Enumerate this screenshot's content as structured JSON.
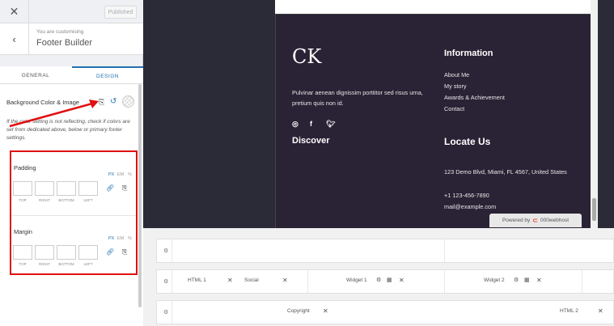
{
  "topbar": {
    "close_icon": "close-icon",
    "published_label": "Published"
  },
  "section": {
    "customizing_label": "You are customising",
    "title": "Footer Builder"
  },
  "tabs": {
    "general": "GENERAL",
    "design": "DESIGN"
  },
  "background": {
    "label": "Background Color & Image",
    "note": "If the color setting is not reflecting, check if colors are set from dedicated above, below or primary footer settings."
  },
  "padding": {
    "title": "Padding",
    "units": [
      "PX",
      "EM",
      "%"
    ],
    "active_unit": "PX",
    "sides": [
      "TOP",
      "RIGHT",
      "BOTTOM",
      "LEFT"
    ]
  },
  "margin": {
    "title": "Margin",
    "units": [
      "PX",
      "EM",
      "%"
    ],
    "active_unit": "PX",
    "sides": [
      "TOP",
      "RIGHT",
      "BOTTOM",
      "LEFT"
    ]
  },
  "footer": {
    "logo": "CK",
    "about": "Pulvinar aenean dignissim porttitor sed risus urna, pretium quis non id.",
    "social_icons": [
      "instagram-icon",
      "facebook-icon",
      "twitter-icon"
    ],
    "info_title": "Information",
    "info_links": [
      "About Me",
      "My story",
      "Awards & Achievement",
      "Contact"
    ],
    "discover_title": "Discover",
    "locate_title": "Locate Us",
    "address": "123 Demo Blvd, Miami, FL 4567, United States",
    "phone": "+1 123-456-7890",
    "email": "mail@example.com"
  },
  "badge": {
    "text": "Powered by",
    "brand": "000webhost"
  },
  "builder": {
    "row2": {
      "html1": "HTML 1",
      "social": "Social",
      "widget1": "Widget 1",
      "widget2": "Widget 2"
    },
    "row3": {
      "copyright": "Copyright",
      "html2": "HTML 2"
    }
  },
  "colors": {
    "accent": "#2271b1",
    "highlight": "#e01010",
    "footer_bg": "#2a2235"
  }
}
